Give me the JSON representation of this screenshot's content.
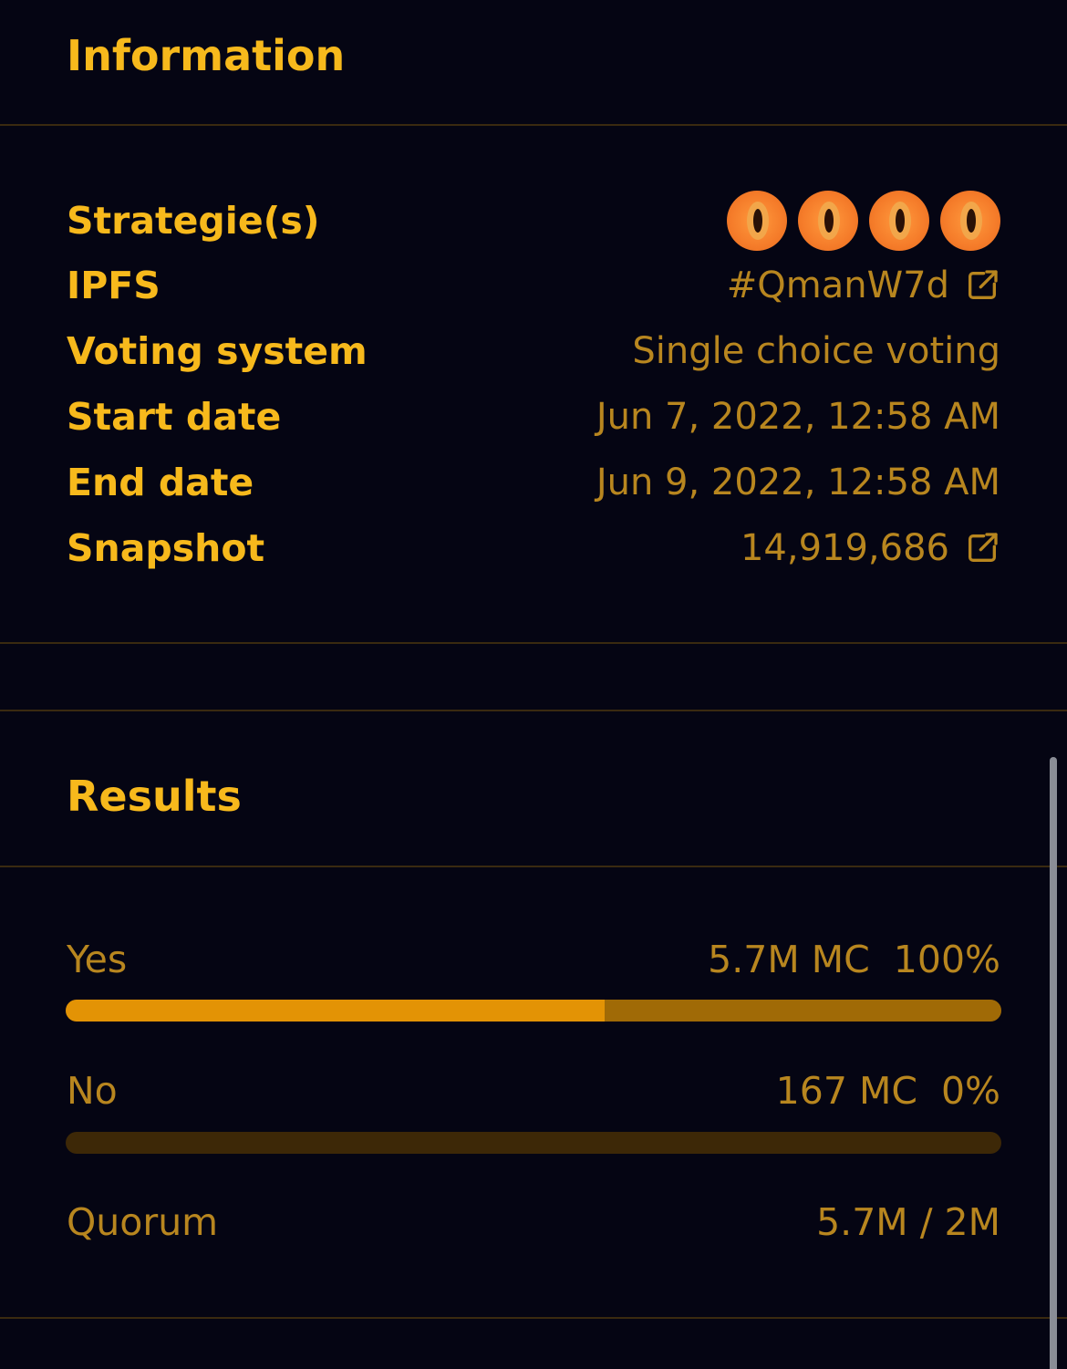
{
  "information": {
    "title": "Information",
    "rows": {
      "strategies": {
        "label": "Strategie(s)",
        "token_count": 4,
        "token_icon": "cat-eye-token-icon"
      },
      "ipfs": {
        "label": "IPFS",
        "value": "#QmanW7d",
        "icon": "external-link-icon"
      },
      "voting_system": {
        "label": "Voting system",
        "value": "Single choice voting"
      },
      "start_date": {
        "label": "Start date",
        "value": "Jun 7, 2022, 12:58 AM"
      },
      "end_date": {
        "label": "End date",
        "value": "Jun 9, 2022, 12:58 AM"
      },
      "snapshot": {
        "label": "Snapshot",
        "value": "14,919,686",
        "icon": "external-link-icon"
      }
    }
  },
  "results": {
    "title": "Results",
    "choices": [
      {
        "label": "Yes",
        "amount": "5.7M MC",
        "percent": "100%",
        "bar_fill": 1.0
      },
      {
        "label": "No",
        "amount": "167 MC",
        "percent": "0%",
        "bar_fill": 0.0
      }
    ],
    "quorum": {
      "label": "Quorum",
      "value": "5.7M / 2M"
    }
  },
  "colors": {
    "background": "#050513",
    "heading": "#f7b91c",
    "value": "#b8861f",
    "divider": "#3a2a10",
    "bar_primary": "#e39305",
    "bar_secondary": "#a06a06",
    "bar_track": "#3d2807"
  }
}
